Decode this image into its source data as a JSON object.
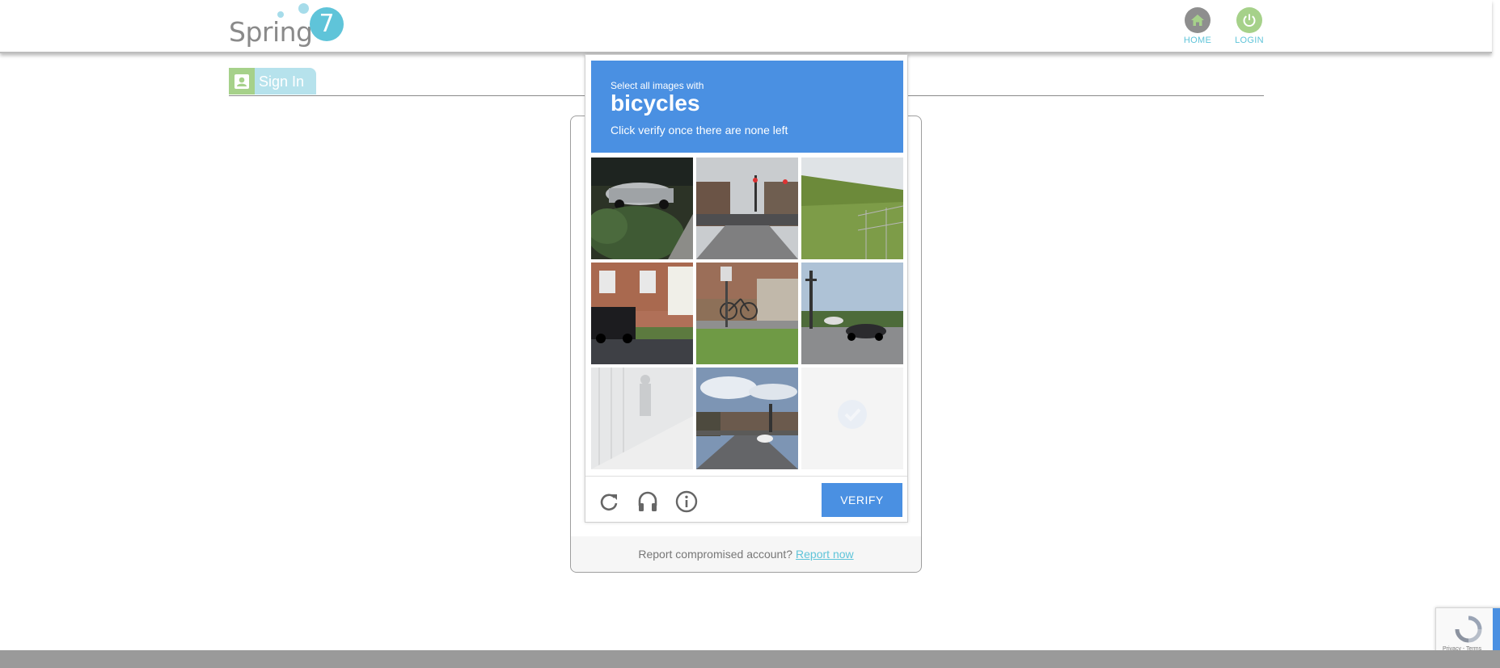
{
  "header": {
    "logo_text": "Spring",
    "logo_number": "7",
    "nav": [
      {
        "label": "HOME",
        "icon": "home-icon"
      },
      {
        "label": "LOGIN",
        "icon": "power-icon"
      }
    ]
  },
  "tab": {
    "label": "Sign In",
    "icon": "user-icon"
  },
  "card": {
    "footer_text": "Report compromised account?",
    "footer_link": "Report now"
  },
  "captcha": {
    "instruction_small": "Select all images with",
    "target": "bicycles",
    "instruction_sub": "Click verify once there are none left",
    "tiles": [
      {
        "scene": "parked cars and bushes",
        "state": "normal"
      },
      {
        "scene": "street with traffic lights",
        "state": "normal"
      },
      {
        "scene": "grassy hill and fence",
        "state": "normal"
      },
      {
        "scene": "house with SUV in driveway",
        "state": "normal"
      },
      {
        "scene": "bicycle at bus stop",
        "state": "normal"
      },
      {
        "scene": "intersection with cars",
        "state": "normal"
      },
      {
        "scene": "sidewalk with railing",
        "state": "fading"
      },
      {
        "scene": "downtown street",
        "state": "normal"
      },
      {
        "scene": "blank",
        "state": "selected-fading"
      }
    ],
    "buttons": {
      "reload": "reload-icon",
      "audio": "headphones-icon",
      "info": "info-icon",
      "verify": "VERIFY"
    }
  },
  "recaptcha_badge": {
    "terms": "Privacy - Terms"
  },
  "colors": {
    "accent": "#4a90e2",
    "brand_teal": "#5fc4d9",
    "brand_green": "#a6d18a"
  }
}
